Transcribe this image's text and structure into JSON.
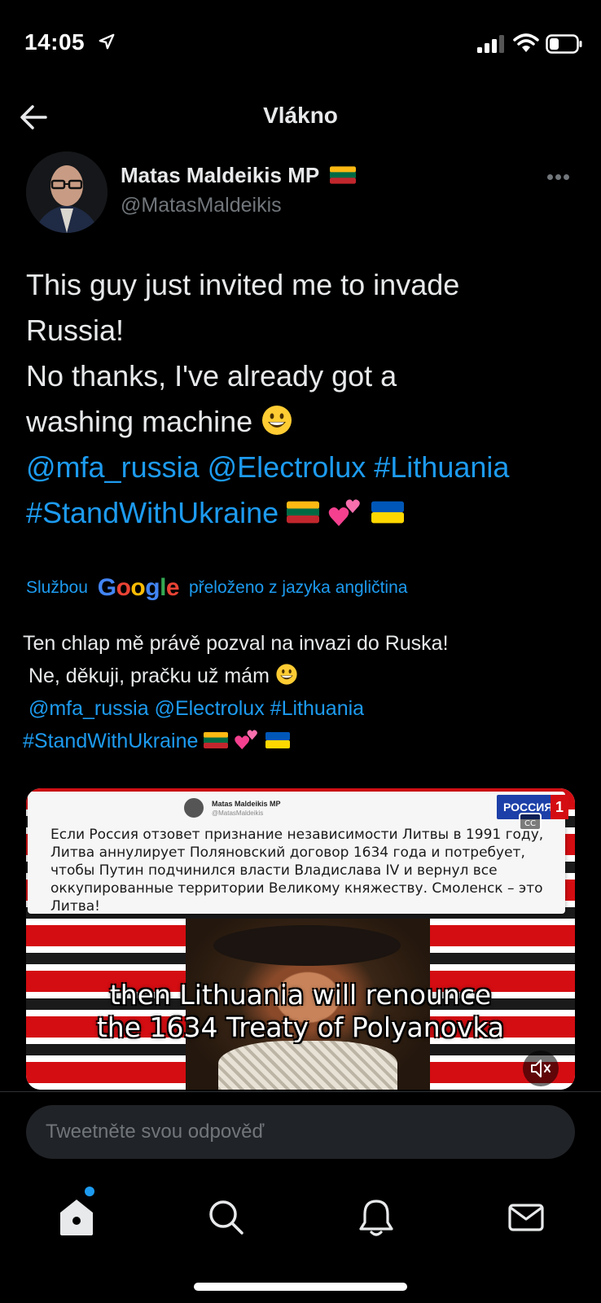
{
  "status_bar": {
    "time": "14:05"
  },
  "header": {
    "title": "Vlákno",
    "back_icon": "arrow-left-icon"
  },
  "tweet": {
    "author_name": "Matas Maldeikis MP",
    "author_handle": "@MatasMaldeikis",
    "text_lines": [
      "This guy just invited me to invade",
      "Russia!",
      "No thanks, I've already got a",
      "washing machine"
    ],
    "mention_1": "@mfa_russia",
    "mention_2": "@Electrolux",
    "hashtag_1": "#Lithuania",
    "hashtag_2": "#StandWithUkraine"
  },
  "translation": {
    "prefix": "Službou",
    "google": [
      "G",
      "o",
      "o",
      "g",
      "l",
      "e"
    ],
    "suffix": "přeloženo z jazyka angličtina",
    "lines": [
      "Ten chlap mě právě pozval na invazi do Ruska!",
      " Ne, děkuji, pračku už mám"
    ],
    "mention_1": "@mfa_russia",
    "mention_2": "@Electrolux",
    "hashtag_1": "#Lithuania",
    "hashtag_2": "#StandWithUkraine"
  },
  "video": {
    "card_author": "Matas Maldeikis MP",
    "card_handle": "@MatasMaldeikis",
    "card_text": "Если Россия отзовет признание независимости Литвы в 1991 году, Литва аннулирует Поляновский договор 1634 года и потребует, чтобы Путин подчинился власти Владислава IV и вернул все оккупированные территории Великому княжеству. Смоленск – это Литва!",
    "channel": "РОССИЯ",
    "channel_num": "1",
    "subtitle_1": "then Lithuania will renounce",
    "subtitle_2": "the 1634 Treaty of Polyanovka"
  },
  "reply": {
    "placeholder": "Tweetněte svou odpověď"
  },
  "tabs": [
    "home-icon",
    "search-icon",
    "bell-icon",
    "mail-icon"
  ],
  "colors": {
    "link": "#1d9bf0",
    "background": "#000000",
    "text": "#e7e9ea",
    "muted": "#71767b"
  }
}
